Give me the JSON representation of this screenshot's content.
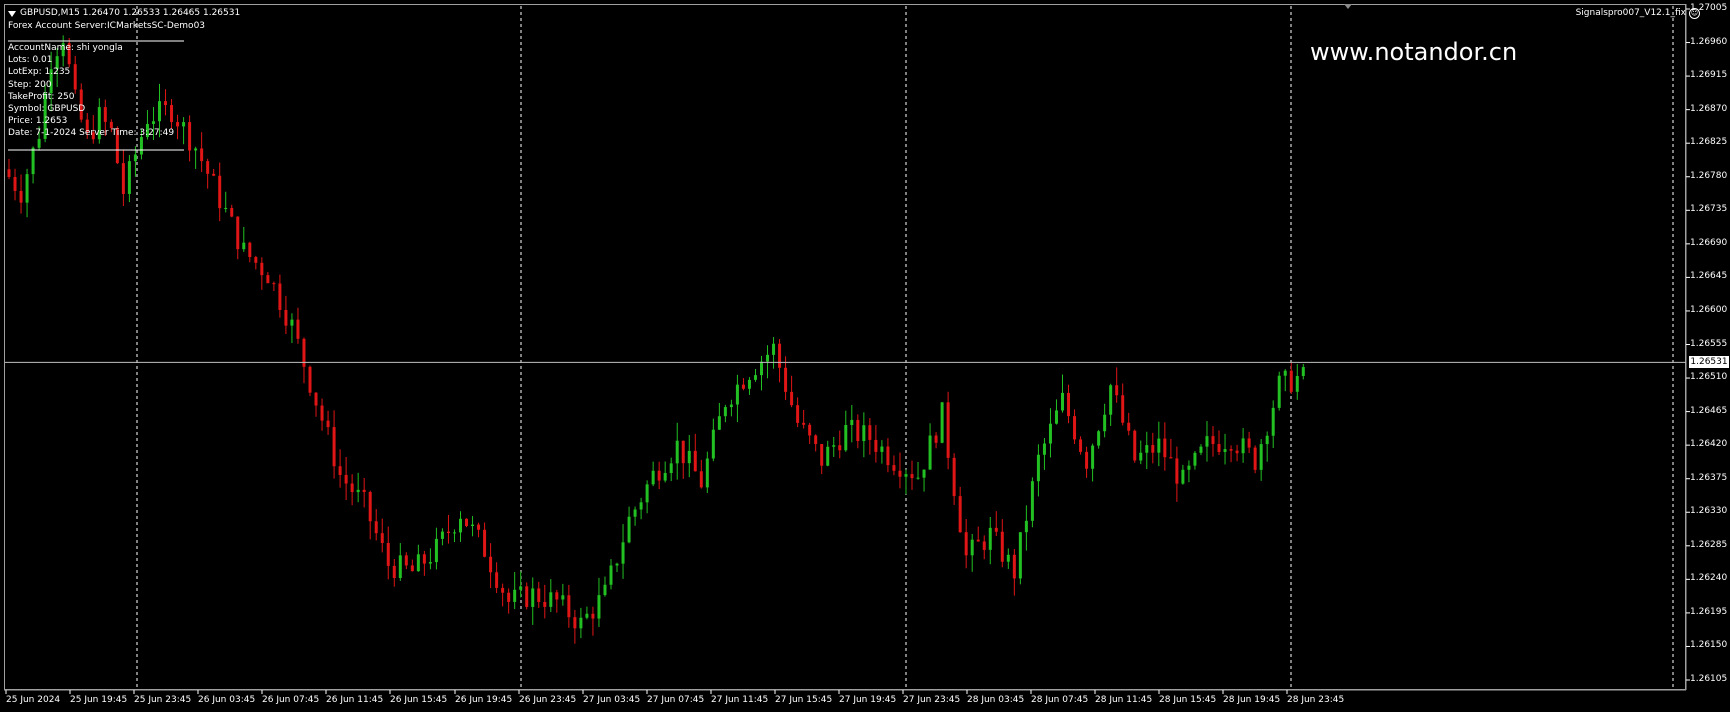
{
  "window": {
    "symbol_header": "GBPUSD,M15  1.26470 1.26533 1.26465 1.26531",
    "server_line": "Forex Account Server:ICMarketsSC-Demo03",
    "indicator_name": "Signalspro007_V12.1_fix",
    "indicator_icon": "smiley-icon"
  },
  "info_panel": [
    "AccountName:  shi yongla",
    "Lots:  0.01",
    "LotExp:  1.235",
    "Step:  200",
    "TakeProfit: 250",
    "Symbol: GBPUSD",
    "Price:  1.2653",
    "Date: 7-1-2024 Server Time: 3:27:49"
  ],
  "watermark": "www.notandor.cn",
  "current_price_label": "1.26531",
  "colors": {
    "background": "#000000",
    "bull_candle": "#22c022",
    "bear_candle": "#e01515",
    "grid_dashes": "#ffffff",
    "price_line": "#c0c0c0",
    "axis_text": "#ffffff"
  },
  "chart_data": {
    "type": "candlestick",
    "symbol": "GBPUSD",
    "timeframe": "M15",
    "current_price": 1.26531,
    "ylim": [
      1.26105,
      1.27005
    ],
    "y_ticks": [
      "1.27005",
      "1.26960",
      "1.26915",
      "1.26870",
      "1.26825",
      "1.26780",
      "1.26735",
      "1.26690",
      "1.26645",
      "1.26600",
      "1.26555",
      "1.26510",
      "1.26465",
      "1.26420",
      "1.26375",
      "1.26330",
      "1.26285",
      "1.26240",
      "1.26195",
      "1.26150",
      "1.26105"
    ],
    "x_ticks": [
      "25 Jun 2024",
      "25 Jun 19:45",
      "25 Jun 23:45",
      "26 Jun 03:45",
      "26 Jun 07:45",
      "26 Jun 11:45",
      "26 Jun 15:45",
      "26 Jun 19:45",
      "26 Jun 23:45",
      "27 Jun 03:45",
      "27 Jun 07:45",
      "27 Jun 11:45",
      "27 Jun 15:45",
      "27 Jun 19:45",
      "27 Jun 23:45",
      "28 Jun 03:45",
      "28 Jun 07:45",
      "28 Jun 11:45",
      "28 Jun 15:45",
      "28 Jun 19:45",
      "28 Jun 23:45"
    ],
    "day_separators": [
      "25 Jun 23:45",
      "26 Jun 23:45",
      "27 Jun 23:45",
      "28 Jun 23:45"
    ],
    "price_path": [
      [
        0,
        1.2679
      ],
      [
        3,
        1.2676
      ],
      [
        6,
        1.2684
      ],
      [
        8,
        1.2694
      ],
      [
        10,
        1.2697
      ],
      [
        12,
        1.2688
      ],
      [
        14,
        1.2683
      ],
      [
        16,
        1.2686
      ],
      [
        18,
        1.2684
      ],
      [
        20,
        1.2676
      ],
      [
        24,
        1.2686
      ],
      [
        28,
        1.2687
      ],
      [
        32,
        1.2682
      ],
      [
        36,
        1.2675
      ],
      [
        40,
        1.2668
      ],
      [
        44,
        1.2665
      ],
      [
        48,
        1.2658
      ],
      [
        52,
        1.2648
      ],
      [
        56,
        1.2638
      ],
      [
        60,
        1.2634
      ],
      [
        64,
        1.2626
      ],
      [
        68,
        1.2625
      ],
      [
        72,
        1.2628
      ],
      [
        76,
        1.2633
      ],
      [
        80,
        1.2628
      ],
      [
        84,
        1.2621
      ],
      [
        88,
        1.2622
      ],
      [
        92,
        1.2621
      ],
      [
        96,
        1.2618
      ],
      [
        100,
        1.2622
      ],
      [
        104,
        1.2632
      ],
      [
        108,
        1.2638
      ],
      [
        112,
        1.2642
      ],
      [
        116,
        1.2637
      ],
      [
        120,
        1.2648
      ],
      [
        124,
        1.2652
      ],
      [
        128,
        1.2655
      ],
      [
        132,
        1.2645
      ],
      [
        136,
        1.264
      ],
      [
        140,
        1.2644
      ],
      [
        144,
        1.2643
      ],
      [
        148,
        1.264
      ],
      [
        152,
        1.2638
      ],
      [
        156,
        1.2646
      ],
      [
        160,
        1.2627
      ],
      [
        164,
        1.263
      ],
      [
        168,
        1.2625
      ],
      [
        172,
        1.264
      ],
      [
        176,
        1.2648
      ],
      [
        180,
        1.264
      ],
      [
        184,
        1.265
      ],
      [
        188,
        1.264
      ],
      [
        192,
        1.2642
      ],
      [
        196,
        1.2637
      ],
      [
        200,
        1.2642
      ],
      [
        204,
        1.2643
      ],
      [
        208,
        1.264
      ],
      [
        212,
        1.265
      ],
      [
        215,
        1.2651
      ]
    ]
  },
  "time_axis_positions": [
    0,
    11.8,
    23.6,
    35.4,
    47.2,
    59,
    70.8,
    82.6,
    94.4,
    106.2,
    118,
    129.8,
    141.6,
    153.4,
    165.2,
    177,
    188.8,
    200.6,
    212.4,
    224.2,
    236
  ]
}
